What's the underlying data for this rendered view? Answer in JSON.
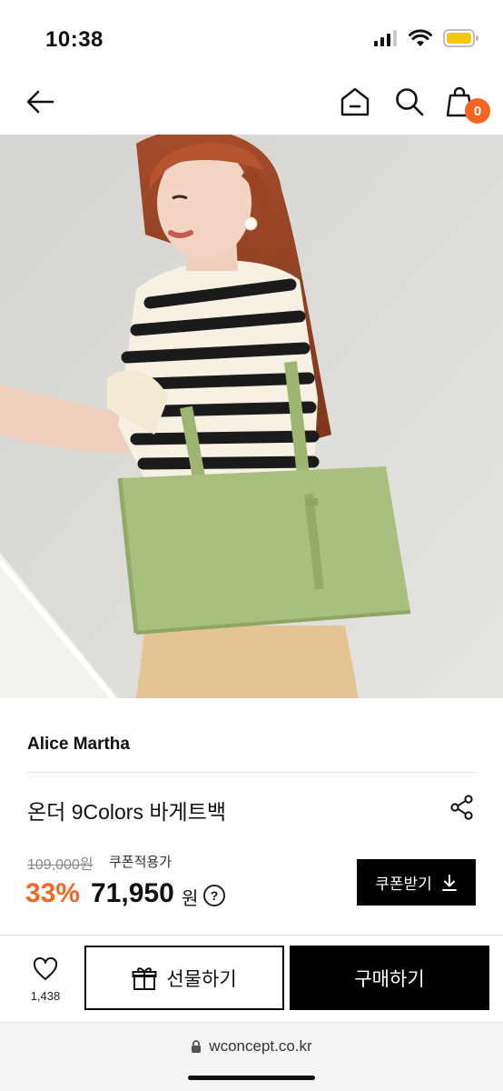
{
  "status": {
    "time": "10:38"
  },
  "nav": {
    "cart_count": "0"
  },
  "product": {
    "brand": "Alice Martha",
    "title": "온더 9Colors 바게트백",
    "original_price": "109,000원",
    "coupon_note": "쿠폰적용가",
    "discount": "33%",
    "price": "71,950",
    "currency": "원",
    "help_symbol": "?"
  },
  "coupon_button": {
    "label": "쿠폰받기"
  },
  "actions": {
    "like_count": "1,438",
    "gift_label": "선물하기",
    "buy_label": "구매하기"
  },
  "browser": {
    "url": "wconcept.co.kr"
  },
  "colors": {
    "accent": "#f26522",
    "bag": "#a9bf7e",
    "battery": "#f2c811"
  }
}
